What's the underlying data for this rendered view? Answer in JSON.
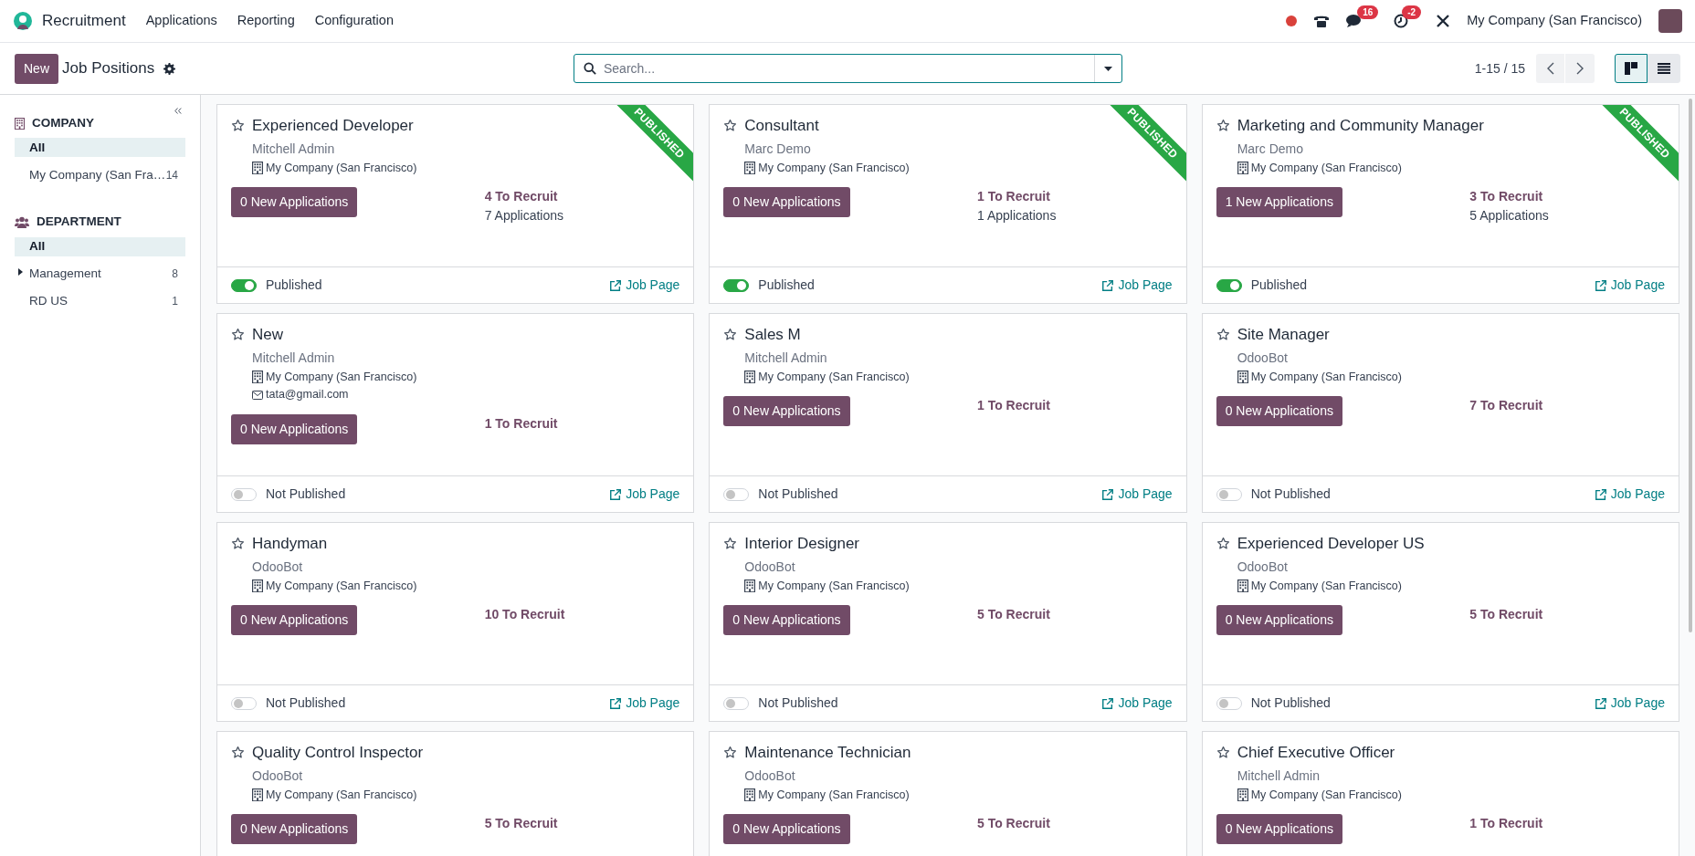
{
  "app": {
    "name": "Recruitment",
    "menu": [
      "Applications",
      "Reporting",
      "Configuration"
    ]
  },
  "systray": {
    "chat_badge": "16",
    "activity_badge": "-2",
    "company": "My Company (San Francisco)"
  },
  "control_panel": {
    "new_button": "New",
    "title": "Job Positions",
    "search": {
      "placeholder": "Search..."
    },
    "pager": "1-15 / 15",
    "views": [
      {
        "kind": "kanban",
        "selected": true
      },
      {
        "kind": "list",
        "selected": false
      }
    ]
  },
  "sidebar": {
    "sections": [
      {
        "kind": "company",
        "title": "COMPANY",
        "items": [
          {
            "label": "All",
            "selected": true
          },
          {
            "label": "My Company (San Fra…",
            "count": "14",
            "selected": false
          }
        ]
      },
      {
        "kind": "department",
        "title": "DEPARTMENT",
        "items": [
          {
            "label": "All",
            "selected": true
          },
          {
            "label": "Management",
            "count": "8",
            "selected": false,
            "expandable": true
          },
          {
            "label": "RD US",
            "count": "1",
            "selected": false
          }
        ]
      }
    ]
  },
  "cards": [
    {
      "title": "Experienced Developer",
      "responsible": "Mitchell Admin",
      "company": "My Company (San Francisco)",
      "new_applications": "0 New Applications",
      "to_recruit": "4 To Recruit",
      "applications": "7 Applications",
      "ribbon": "PUBLISHED",
      "published": true,
      "status_label": "Published",
      "link": "Job Page"
    },
    {
      "title": "Consultant",
      "responsible": "Marc Demo",
      "company": "My Company (San Francisco)",
      "new_applications": "0 New Applications",
      "to_recruit": "1 To Recruit",
      "applications": "1 Applications",
      "ribbon": "PUBLISHED",
      "published": true,
      "status_label": "Published",
      "link": "Job Page"
    },
    {
      "title": "Marketing and Community Manager",
      "responsible": "Marc Demo",
      "company": "My Company (San Francisco)",
      "new_applications": "1 New Applications",
      "to_recruit": "3 To Recruit",
      "applications": "5 Applications",
      "ribbon": "PUBLISHED",
      "published": true,
      "status_label": "Published",
      "link": "Job Page"
    },
    {
      "title": "New",
      "responsible": "Mitchell Admin",
      "company": "My Company (San Francisco)",
      "email": "tata@gmail.com",
      "new_applications": "0 New Applications",
      "to_recruit": "1 To Recruit",
      "published": false,
      "status_label": "Not Published",
      "link": "Job Page"
    },
    {
      "title": "Sales M",
      "responsible": "Mitchell Admin",
      "company": "My Company (San Francisco)",
      "new_applications": "0 New Applications",
      "to_recruit": "1 To Recruit",
      "published": false,
      "status_label": "Not Published",
      "link": "Job Page"
    },
    {
      "title": "Site Manager",
      "responsible": "OdooBot",
      "company": "My Company (San Francisco)",
      "new_applications": "0 New Applications",
      "to_recruit": "7 To Recruit",
      "published": false,
      "status_label": "Not Published",
      "link": "Job Page"
    },
    {
      "title": "Handyman",
      "responsible": "OdooBot",
      "company": "My Company (San Francisco)",
      "new_applications": "0 New Applications",
      "to_recruit": "10 To Recruit",
      "published": false,
      "status_label": "Not Published",
      "link": "Job Page"
    },
    {
      "title": "Interior Designer",
      "responsible": "OdooBot",
      "company": "My Company (San Francisco)",
      "new_applications": "0 New Applications",
      "to_recruit": "5 To Recruit",
      "published": false,
      "status_label": "Not Published",
      "link": "Job Page"
    },
    {
      "title": "Experienced Developer US",
      "responsible": "OdooBot",
      "company": "My Company (San Francisco)",
      "new_applications": "0 New Applications",
      "to_recruit": "5 To Recruit",
      "published": false,
      "status_label": "Not Published",
      "link": "Job Page"
    },
    {
      "title": "Quality Control Inspector",
      "responsible": "OdooBot",
      "company": "My Company (San Francisco)",
      "new_applications": "0 New Applications",
      "to_recruit": "5 To Recruit"
    },
    {
      "title": "Maintenance Technician",
      "responsible": "OdooBot",
      "company": "My Company (San Francisco)",
      "new_applications": "0 New Applications",
      "to_recruit": "5 To Recruit"
    },
    {
      "title": "Chief Executive Officer",
      "responsible": "Mitchell Admin",
      "company": "My Company (San Francisco)",
      "new_applications": "0 New Applications",
      "to_recruit": "1 To Recruit"
    }
  ]
}
